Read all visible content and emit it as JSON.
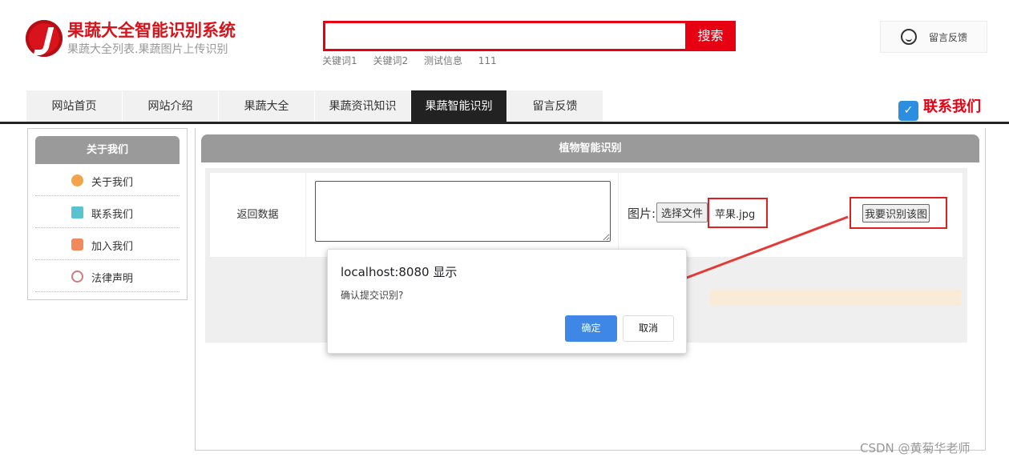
{
  "header": {
    "title": "果蔬大全智能识别系统",
    "subtitle": "果蔬大全列表.果蔬图片上传识别",
    "search_placeholder": "",
    "search_button": "搜索",
    "keywords": [
      "关键词1",
      "关键词2",
      "测试信息",
      "111"
    ],
    "feedback": "留言反馈"
  },
  "nav": {
    "items": [
      "网站首页",
      "网站介绍",
      "果蔬大全",
      "果蔬资讯知识",
      "果蔬智能识别",
      "留言反馈"
    ],
    "active_index": 4,
    "contact": "联系我们"
  },
  "sidebar": {
    "title": "关于我们",
    "items": [
      "关于我们",
      "联系我们",
      "加入我们",
      "法律声明"
    ]
  },
  "main": {
    "title": "植物智能识别",
    "return_label": "返回数据",
    "textarea_value": "",
    "picture_label": "图片:",
    "file_button": "选择文件",
    "file_name": "苹果.jpg",
    "identify_button": "我要识别该图"
  },
  "dialog": {
    "title": "localhost:8080 显示",
    "message": "确认提交识别?",
    "ok": "确定",
    "cancel": "取消"
  },
  "watermark": "CSDN @黄菊华老师",
  "colors": {
    "brand_red": "#e60012",
    "nav_active": "#222222",
    "ok_blue": "#3f87e6"
  }
}
